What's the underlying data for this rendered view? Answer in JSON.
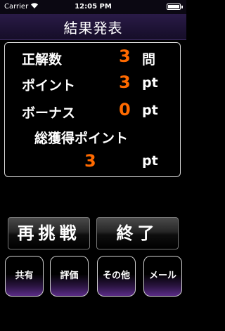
{
  "status_bar": {
    "carrier": "Carrier",
    "time": "12:05 PM"
  },
  "header": {
    "title": "結果発表"
  },
  "results": {
    "correct": {
      "label": "正解数",
      "value": "3",
      "unit": "問"
    },
    "points": {
      "label": "ポイント",
      "value": "3",
      "unit": "pt"
    },
    "bonus": {
      "label": "ボーナス",
      "value": "0",
      "unit": "pt"
    },
    "total": {
      "label": "総獲得ポイント",
      "value": "3",
      "unit": "pt"
    }
  },
  "actions": {
    "retry_label": "再挑戦",
    "finish_label": "終了",
    "share_label": "共有",
    "rate_label": "評価",
    "other_label": "その他",
    "mail_label": "メール"
  },
  "colors": {
    "accent_value": "#ff6a00",
    "header_purple": "#1d1234"
  }
}
